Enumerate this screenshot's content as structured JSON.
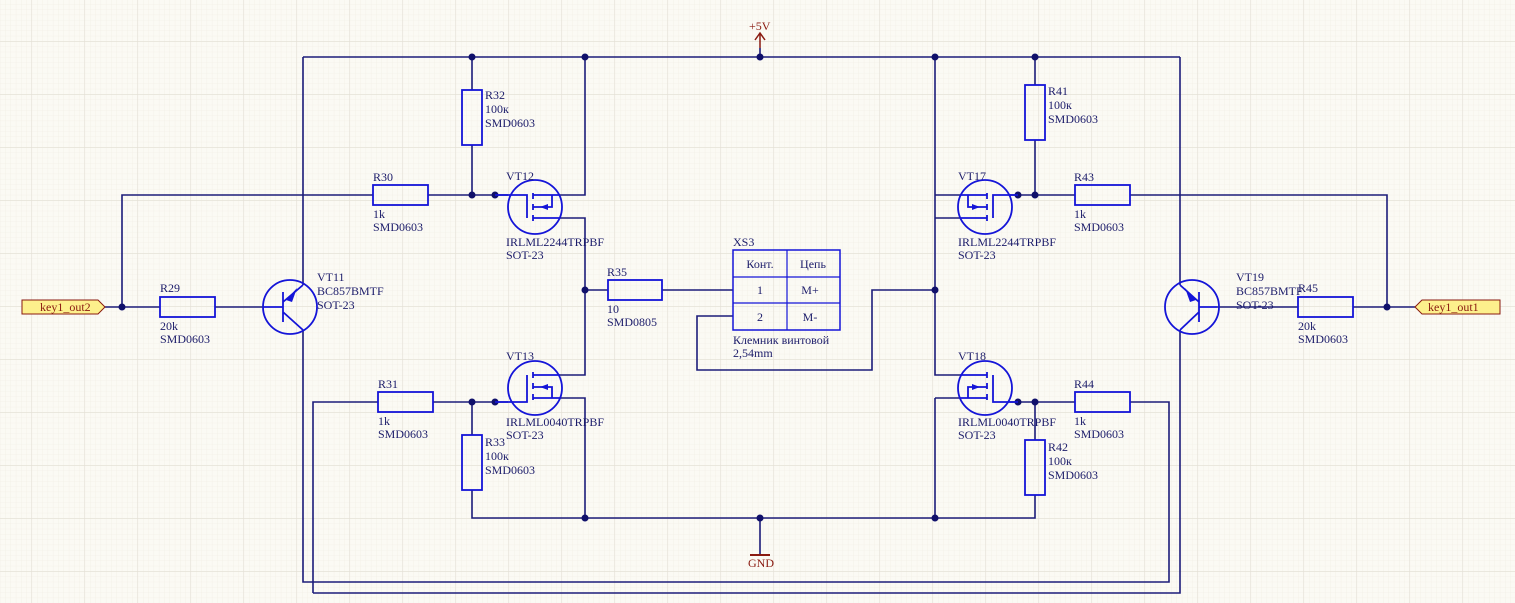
{
  "power": {
    "vcc": "+5V",
    "gnd": "GND"
  },
  "ports": {
    "left": "key1_out2",
    "right": "key1_out1"
  },
  "colors": {
    "wire": "#1c1c7a",
    "component": "#1414d8",
    "power": "#8a1a10",
    "port_fill": "#fdf08c",
    "background": "#fbfaf4"
  },
  "parts": {
    "R29": {
      "ref": "R29",
      "value": "20k",
      "pkg": "SMD0603"
    },
    "R30": {
      "ref": "R30",
      "value": "1k",
      "pkg": "SMD0603"
    },
    "R31": {
      "ref": "R31",
      "value": "1k",
      "pkg": "SMD0603"
    },
    "R32": {
      "ref": "R32",
      "value": "100к",
      "pkg": "SMD0603"
    },
    "R33": {
      "ref": "R33",
      "value": "100к",
      "pkg": "SMD0603"
    },
    "R35": {
      "ref": "R35",
      "value": "10",
      "pkg": "SMD0805"
    },
    "R41": {
      "ref": "R41",
      "value": "100к",
      "pkg": "SMD0603"
    },
    "R42": {
      "ref": "R42",
      "value": "100к",
      "pkg": "SMD0603"
    },
    "R43": {
      "ref": "R43",
      "value": "1k",
      "pkg": "SMD0603"
    },
    "R44": {
      "ref": "R44",
      "value": "1k",
      "pkg": "SMD0603"
    },
    "R45": {
      "ref": "R45",
      "value": "20k",
      "pkg": "SMD0603"
    },
    "VT11": {
      "ref": "VT11",
      "value": "BC857BMTF",
      "pkg": "SOT-23"
    },
    "VT19": {
      "ref": "VT19",
      "value": "BC857BMTF",
      "pkg": "SOT-23"
    },
    "VT12": {
      "ref": "VT12",
      "value": "IRLML2244TRPBF",
      "pkg": "SOT-23"
    },
    "VT17": {
      "ref": "VT17",
      "value": "IRLML2244TRPBF",
      "pkg": "SOT-23"
    },
    "VT13": {
      "ref": "VT13",
      "value": "IRLML0040TRPBF",
      "pkg": "SOT-23"
    },
    "VT18": {
      "ref": "VT18",
      "value": "IRLML0040TRPBF",
      "pkg": "SOT-23"
    }
  },
  "connector": {
    "ref": "XS3",
    "headers": [
      "Конт.",
      "Цепь"
    ],
    "rows": [
      [
        "1",
        "M+"
      ],
      [
        "2",
        "M-"
      ]
    ],
    "desc": "Клемник винтовой",
    "pitch": "2,54mm"
  }
}
